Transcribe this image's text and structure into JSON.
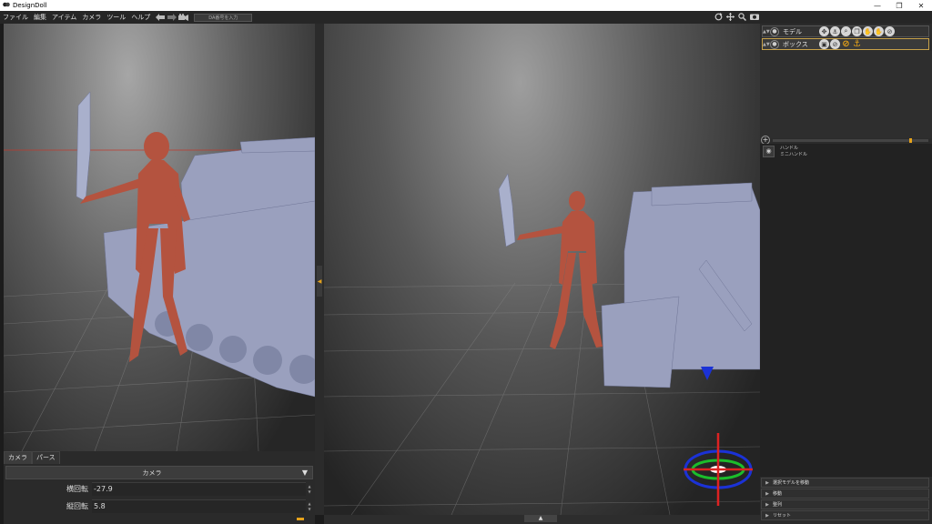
{
  "window": {
    "title": "DesignDoll",
    "minimize": "—",
    "maximize": "❐",
    "close": "✕"
  },
  "menu": {
    "items": [
      "ファイル",
      "編集",
      "アイテム",
      "カメラ",
      "ツール",
      "ヘルプ"
    ],
    "da_placeholder": "DA番号を入力"
  },
  "camera_panel": {
    "tabs": [
      "カメラ",
      "パース"
    ],
    "dropdown": "カメラ",
    "rows": [
      {
        "label": "横回転",
        "value": "-27.9"
      },
      {
        "label": "縦回転",
        "value": "5.8"
      }
    ]
  },
  "layers": [
    {
      "name": "モデル"
    },
    {
      "name": "ボックス"
    }
  ],
  "handle": {
    "line1": "ハンドル",
    "line2": "ミニハンドル"
  },
  "accordion": [
    "選択モデルを移動",
    "移動",
    "整列",
    "リセット"
  ],
  "colors": {
    "accent": "#e5a21b",
    "figure": "#b4533f",
    "tank": "#9aa0be"
  }
}
